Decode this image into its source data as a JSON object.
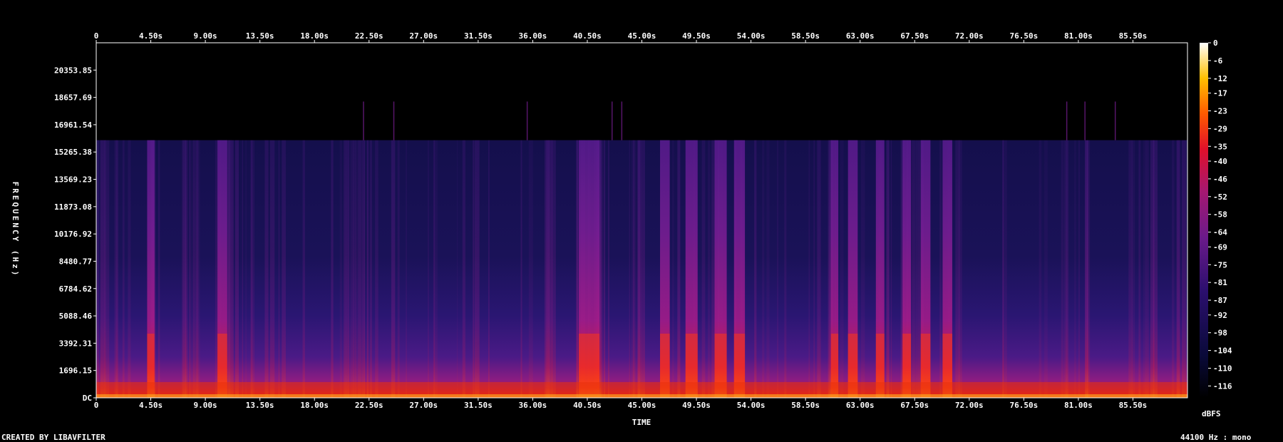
{
  "chart_data": {
    "type": "heatmap",
    "title": "",
    "xlabel": "TIME",
    "ylabel": "FREQUENCY (Hz)",
    "x_ticks": [
      "0",
      "4.50s",
      "9.00s",
      "13.50s",
      "18.00s",
      "22.50s",
      "27.00s",
      "31.50s",
      "36.00s",
      "40.50s",
      "45.00s",
      "49.50s",
      "54.00s",
      "58.50s",
      "63.00s",
      "67.50s",
      "72.00s",
      "76.50s",
      "81.00s",
      "85.50s"
    ],
    "y_ticks": [
      "DC",
      "1696.15",
      "3392.31",
      "5088.46",
      "6784.62",
      "8480.77",
      "10176.92",
      "11873.08",
      "13569.23",
      "15265.38",
      "16961.54",
      "18657.69",
      "20353.85"
    ],
    "xlim": [
      0,
      90
    ],
    "ylim": [
      0,
      22050
    ],
    "cutoff_hz": 16000,
    "colorbar": {
      "label": "dBFS",
      "ticks": [
        "0",
        "-6",
        "-12",
        "-17",
        "-23",
        "-29",
        "-35",
        "-40",
        "-46",
        "-52",
        "-58",
        "-64",
        "-69",
        "-75",
        "-81",
        "-87",
        "-92",
        "-98",
        "-104",
        "-110",
        "-116"
      ],
      "range": [
        -120,
        0
      ]
    },
    "energetic_segments_s": [
      [
        4.2,
        4.8
      ],
      [
        10.0,
        10.8
      ],
      [
        39.8,
        41.5
      ],
      [
        46.5,
        47.3
      ],
      [
        48.6,
        49.6
      ],
      [
        51.0,
        52.0
      ],
      [
        52.6,
        53.5
      ],
      [
        60.6,
        61.2
      ],
      [
        62.0,
        62.8
      ],
      [
        64.3,
        65.0
      ],
      [
        66.5,
        67.2
      ],
      [
        68.0,
        68.8
      ],
      [
        69.8,
        70.6
      ]
    ],
    "footer_left": "CREATED BY LIBAVFILTER",
    "footer_right": "44100 Hz : mono"
  }
}
